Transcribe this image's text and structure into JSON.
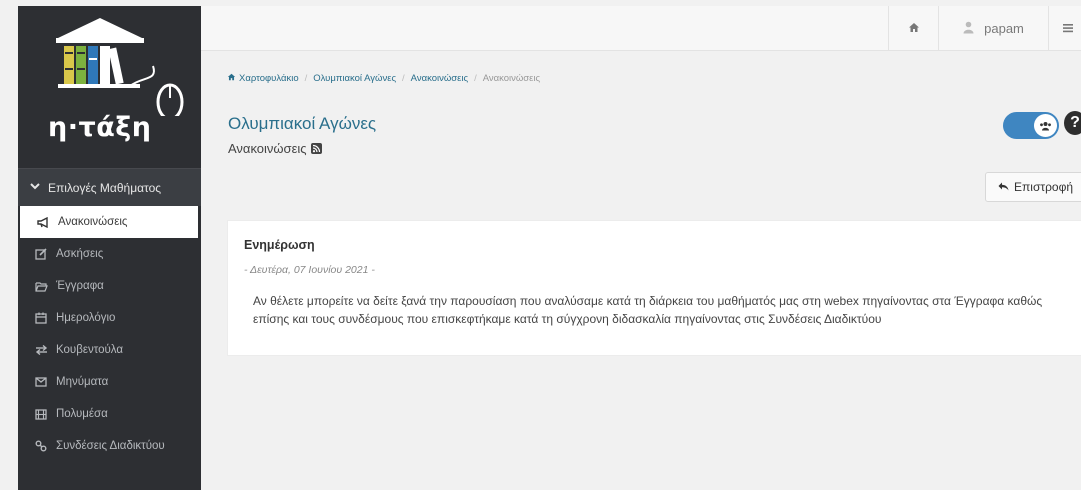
{
  "logo": {
    "text": "η·τάξη"
  },
  "sidebar": {
    "section_label": "Επιλογές Μαθήματος",
    "items": [
      {
        "label": "Ανακοινώσεις",
        "icon": "megaphone-icon",
        "active": true
      },
      {
        "label": "Ασκήσεις",
        "icon": "edit-icon",
        "active": false
      },
      {
        "label": "Έγγραφα",
        "icon": "folder-open-icon",
        "active": false
      },
      {
        "label": "Ημερολόγιο",
        "icon": "calendar-icon",
        "active": false
      },
      {
        "label": "Κουβεντούλα",
        "icon": "exchange-icon",
        "active": false
      },
      {
        "label": "Μηνύματα",
        "icon": "envelope-icon",
        "active": false
      },
      {
        "label": "Πολυμέσα",
        "icon": "film-icon",
        "active": false
      },
      {
        "label": "Συνδέσεις Διαδικτύου",
        "icon": "link-icon",
        "active": false
      }
    ]
  },
  "topbar": {
    "home_icon": "home-icon",
    "user_icon": "user-icon",
    "username": "papam",
    "menu_icon": "bars-icon"
  },
  "breadcrumb": {
    "items": [
      "Χαρτοφυλάκιο",
      "Ολυμπιακοί Αγώνες",
      "Ανακοινώσεις"
    ],
    "current": "Ανακοινώσεις"
  },
  "page": {
    "title": "Ολυμπιακοί Αγώνες",
    "subtitle": "Ανακοινώσεις",
    "back_label": "Επιστροφή",
    "help_label": "?"
  },
  "announcement": {
    "title": "Ενημέρωση",
    "date": "- Δευτέρα, 07 Ιουνίου 2021 -",
    "body": "Αν θέλετε μπορείτε να δείτε ξανά την παρουσίαση που αναλύσαμε κατά τη διάρκεια του μαθήματός μας στη webex πηγαίνοντας στα Έγγραφα  καθώς επίσης και τους συνδέσμους που επισκεφτήκαμε κατά τη σύγχρονη διδασκαλία πηγαίνοντας στις Συνδέσεις Διαδικτύου"
  },
  "colors": {
    "sidebar_bg": "#2d2f33",
    "accent": "#2a6f8c",
    "toggle": "#3f86c1"
  }
}
